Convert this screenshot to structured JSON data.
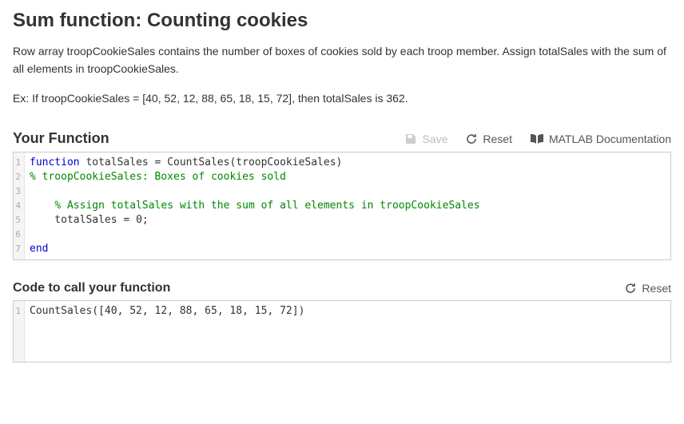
{
  "page": {
    "title": "Sum function: Counting cookies",
    "description": "Row array troopCookieSales contains the number of boxes of cookies sold by each troop member. Assign totalSales with the sum of all elements in troopCookieSales.",
    "example": "Ex: If troopCookieSales = [40, 52, 12, 88, 65, 18, 15, 72], then totalSales is 362."
  },
  "function_section": {
    "heading": "Your Function",
    "toolbar": {
      "save_label": "Save",
      "reset_label": "Reset",
      "docs_label": "MATLAB Documentation"
    },
    "code_lines": [
      {
        "n": 1,
        "segments": [
          {
            "t": "function",
            "c": "keyword"
          },
          {
            "t": " totalSales = CountSales(troopCookieSales)",
            "c": "plain"
          }
        ]
      },
      {
        "n": 2,
        "segments": [
          {
            "t": "% troopCookieSales: Boxes of cookies sold",
            "c": "comment"
          }
        ]
      },
      {
        "n": 3,
        "segments": []
      },
      {
        "n": 4,
        "segments": [
          {
            "t": "    ",
            "c": "plain"
          },
          {
            "t": "% Assign totalSales with the sum of all elements in troopCookieSales",
            "c": "comment"
          }
        ]
      },
      {
        "n": 5,
        "segments": [
          {
            "t": "    totalSales = ",
            "c": "plain"
          },
          {
            "t": "0",
            "c": "number"
          },
          {
            "t": ";",
            "c": "plain"
          }
        ]
      },
      {
        "n": 6,
        "segments": []
      },
      {
        "n": 7,
        "segments": [
          {
            "t": "end",
            "c": "keyword"
          }
        ]
      }
    ]
  },
  "call_section": {
    "heading": "Code to call your function",
    "toolbar": {
      "reset_label": "Reset"
    },
    "code_lines": [
      {
        "n": 1,
        "segments": [
          {
            "t": "CountSales([",
            "c": "plain"
          },
          {
            "t": "40",
            "c": "number"
          },
          {
            "t": ", ",
            "c": "plain"
          },
          {
            "t": "52",
            "c": "number"
          },
          {
            "t": ", ",
            "c": "plain"
          },
          {
            "t": "12",
            "c": "number"
          },
          {
            "t": ", ",
            "c": "plain"
          },
          {
            "t": "88",
            "c": "number"
          },
          {
            "t": ", ",
            "c": "plain"
          },
          {
            "t": "65",
            "c": "number"
          },
          {
            "t": ", ",
            "c": "plain"
          },
          {
            "t": "18",
            "c": "number"
          },
          {
            "t": ", ",
            "c": "plain"
          },
          {
            "t": "15",
            "c": "number"
          },
          {
            "t": ", ",
            "c": "plain"
          },
          {
            "t": "72",
            "c": "number"
          },
          {
            "t": "])",
            "c": "plain"
          }
        ]
      }
    ]
  }
}
